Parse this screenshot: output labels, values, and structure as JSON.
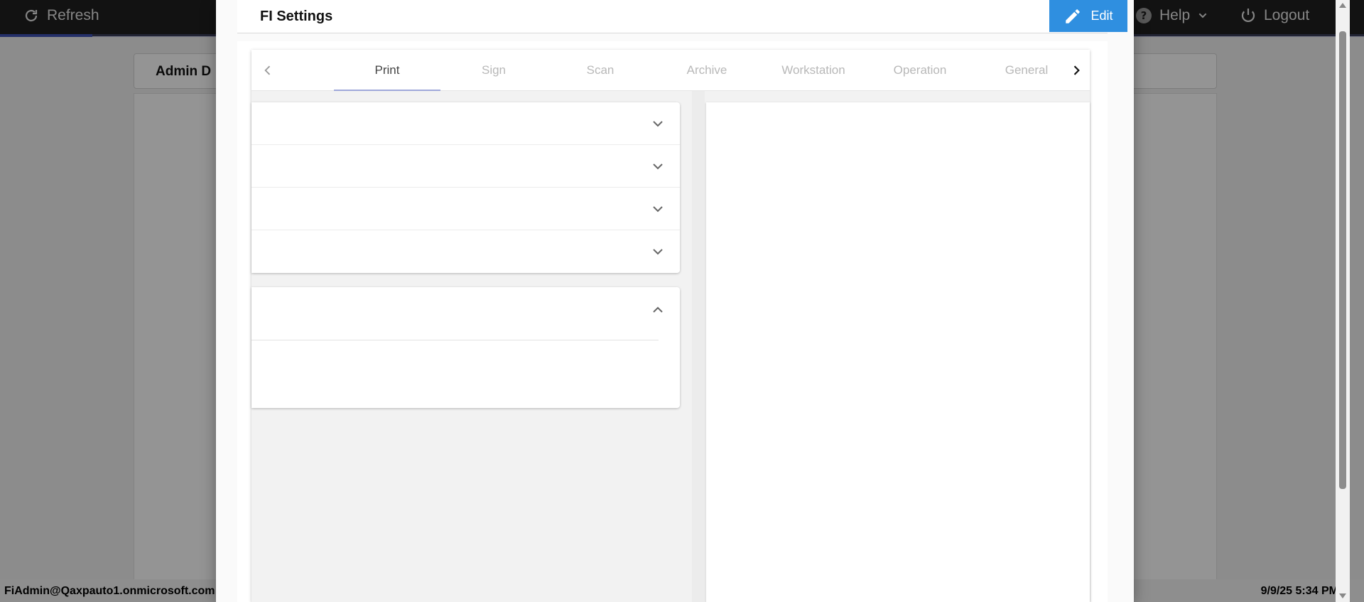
{
  "topbar": {
    "refresh_label": "Refresh",
    "help_label": "Help",
    "logout_label": "Logout"
  },
  "background": {
    "card_title": "Admin D",
    "user": "FiAdmin@Qaxpauto1.onmicrosoft.com",
    "datetime": "9/9/25 5:34 PM"
  },
  "dialog": {
    "title": "FI Settings",
    "edit_label": "Edit",
    "tabs": [
      {
        "label": "Print",
        "active": true
      },
      {
        "label": "Sign",
        "active": false
      },
      {
        "label": "Scan",
        "active": false
      },
      {
        "label": "Archive",
        "active": false
      },
      {
        "label": "Workstation",
        "active": false
      },
      {
        "label": "Operation",
        "active": false
      },
      {
        "label": "General",
        "active": false
      }
    ]
  },
  "colors": {
    "accent": "#2f8fe0",
    "tab_indicator": "#9fa8da",
    "topbar": "#1f1f1f"
  },
  "icons": {
    "refresh": "refresh-icon",
    "help": "help-icon",
    "logout": "power-icon",
    "edit": "pencil-icon",
    "tab_prev": "chevron-left-icon",
    "tab_next": "chevron-right-icon",
    "expand": "chevron-down-icon",
    "collapse": "chevron-up-icon"
  }
}
